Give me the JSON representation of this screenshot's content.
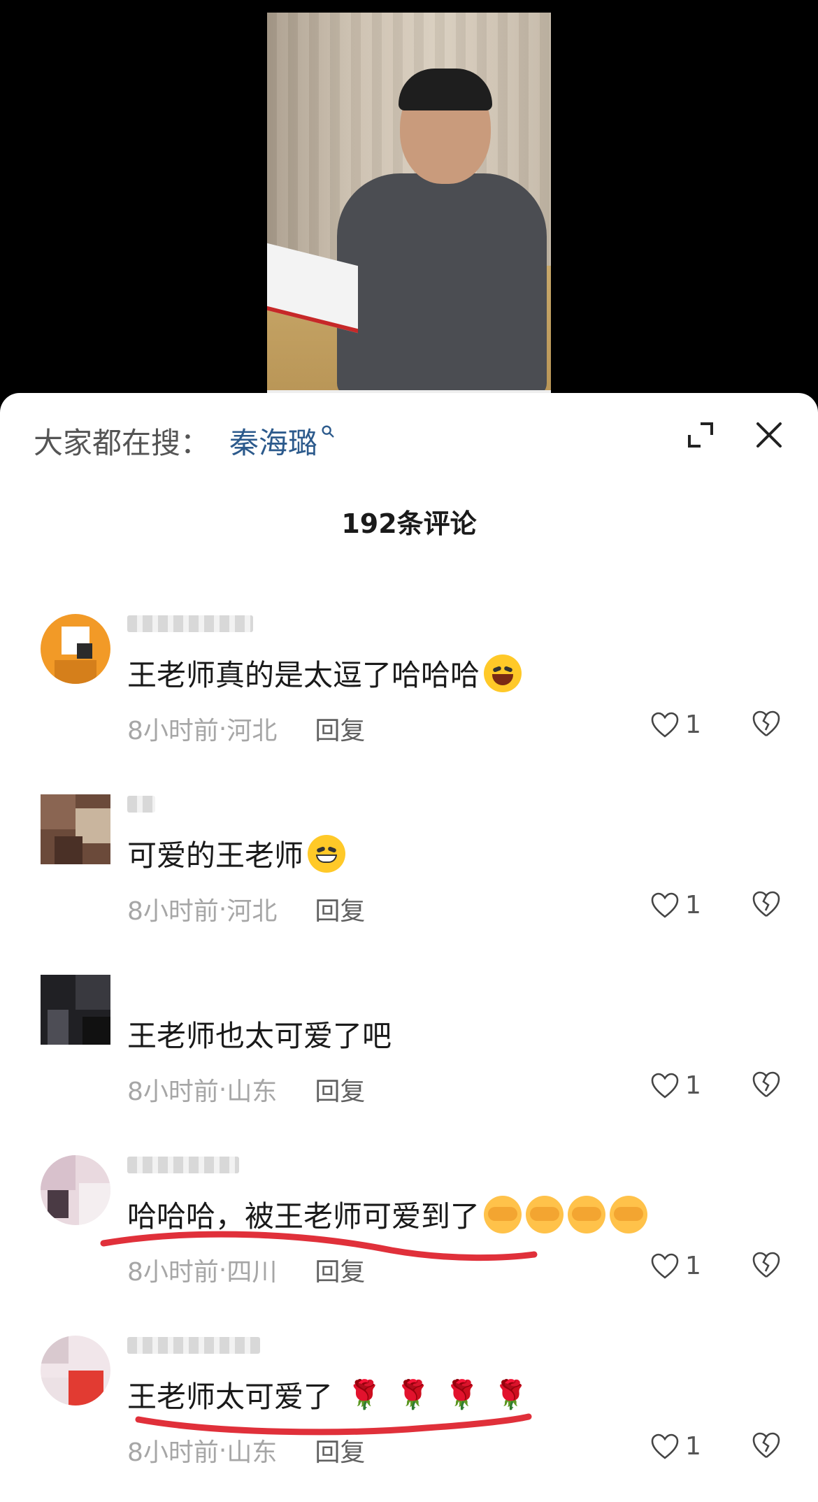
{
  "sheet": {
    "search_label": "大家都在搜：",
    "search_term": "秦海璐",
    "comment_count": "192条评论"
  },
  "comments": [
    {
      "text": "王老师真的是太逗了哈哈哈",
      "time": "8小时前",
      "location": "河北",
      "reply": "回复",
      "likes": "1",
      "emoji": "laughing-tears-emoji"
    },
    {
      "text": "可爱的王老师",
      "time": "8小时前",
      "location": "河北",
      "reply": "回复",
      "likes": "1",
      "emoji": "grin-emoji"
    },
    {
      "text": "王老师也太可爱了吧",
      "time": "8小时前",
      "location": "山东",
      "reply": "回复",
      "likes": "1"
    },
    {
      "text": "哈哈哈，被王老师可爱到了",
      "time": "8小时前",
      "location": "四川",
      "reply": "回复",
      "likes": "1",
      "emoji": "face-covering-emoji"
    },
    {
      "text": "王老师太可爱了",
      "time": "8小时前",
      "location": "山东",
      "reply": "回复",
      "likes": "1",
      "emoji": "rose-emoji"
    }
  ],
  "colors": {
    "search_term": "#2c5a8c",
    "underline": "#e0303a"
  }
}
